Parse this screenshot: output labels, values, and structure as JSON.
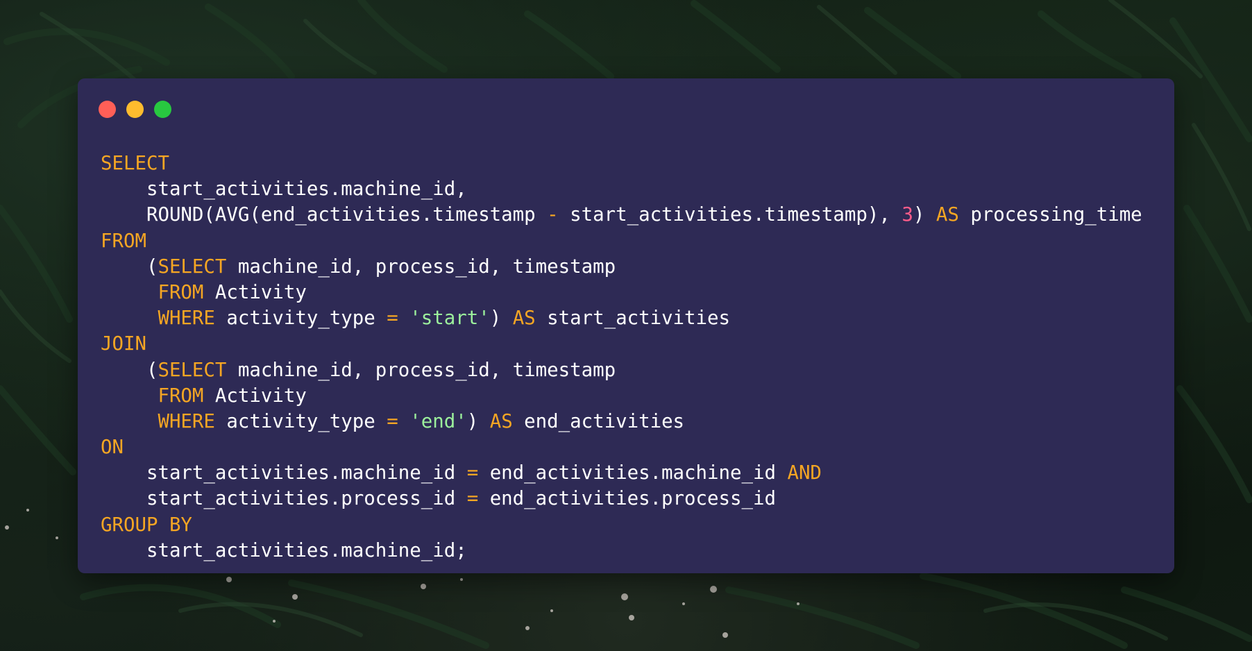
{
  "colors": {
    "window_background": "#2e2a55",
    "keyword": "#f5a623",
    "number": "#ff5c8a",
    "string": "#9cf09c",
    "text": "#ffffff",
    "close": "#ff5f57",
    "minimize": "#febc2e",
    "maximize": "#28c840"
  },
  "window_controls": [
    "close-dot",
    "minimize-dot",
    "maximize-dot"
  ],
  "code": {
    "l1": {
      "kw": "SELECT"
    },
    "l2": {
      "t1": "    start_activities.machine_id,"
    },
    "l3": {
      "t1": "    ROUND(AVG(end_activities.timestamp ",
      "op1": "-",
      "t2": " start_activities.timestamp), ",
      "num": "3",
      "t3": ") ",
      "kw": "AS",
      "t4": " processing_time"
    },
    "l4": {
      "kw": "FROM"
    },
    "l5": {
      "t1": "    (",
      "kw": "SELECT",
      "t2": " machine_id, process_id, timestamp"
    },
    "l6": {
      "t1": "     ",
      "kw": "FROM",
      "t2": " Activity"
    },
    "l7": {
      "t1": "     ",
      "kw1": "WHERE",
      "t2": " activity_type ",
      "op": "=",
      "t3": " ",
      "str": "'start'",
      "t4": ") ",
      "kw2": "AS",
      "t5": " start_activities"
    },
    "l8": {
      "kw": "JOIN"
    },
    "l9": {
      "t1": "    (",
      "kw": "SELECT",
      "t2": " machine_id, process_id, timestamp"
    },
    "l10": {
      "t1": "     ",
      "kw": "FROM",
      "t2": " Activity"
    },
    "l11": {
      "t1": "     ",
      "kw1": "WHERE",
      "t2": " activity_type ",
      "op": "=",
      "t3": " ",
      "str": "'end'",
      "t4": ") ",
      "kw2": "AS",
      "t5": " end_activities"
    },
    "l12": {
      "kw": "ON"
    },
    "l13": {
      "t1": "    start_activities.machine_id ",
      "op": "=",
      "t2": " end_activities.machine_id ",
      "kw": "AND"
    },
    "l14": {
      "t1": "    start_activities.process_id ",
      "op": "=",
      "t2": " end_activities.process_id"
    },
    "l15": {
      "kw": "GROUP BY"
    },
    "l16": {
      "t1": "    start_activities.machine_id;"
    }
  }
}
